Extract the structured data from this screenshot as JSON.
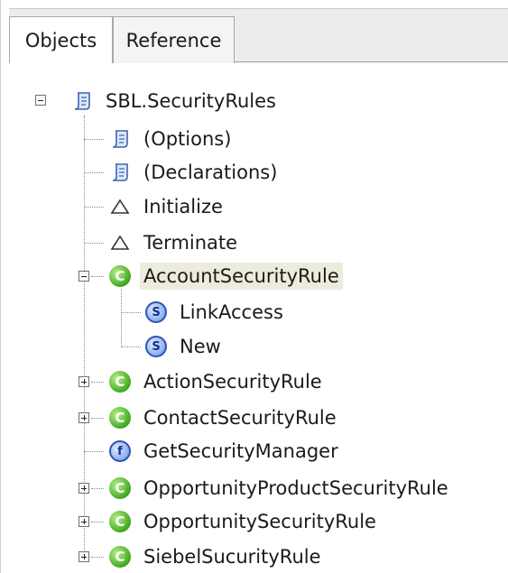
{
  "tabs": [
    {
      "label": "Objects",
      "active": true
    },
    {
      "label": "Reference",
      "active": false
    }
  ],
  "tree": {
    "root": {
      "label": "SBL.SecurityRules",
      "icon": "script-icon",
      "expanded": true
    },
    "items": [
      {
        "label": "(Options)",
        "icon": "script-icon"
      },
      {
        "label": "(Declarations)",
        "icon": "script-icon"
      },
      {
        "label": "Initialize",
        "icon": "triangle-icon"
      },
      {
        "label": "Terminate",
        "icon": "triangle-icon"
      },
      {
        "label": "AccountSecurityRule",
        "icon": "class-icon",
        "expanded": true,
        "selected": true,
        "children": [
          {
            "label": "LinkAccess",
            "icon": "sub-icon"
          },
          {
            "label": "New",
            "icon": "sub-icon"
          }
        ]
      },
      {
        "label": "ActionSecurityRule",
        "icon": "class-icon",
        "expanded": false
      },
      {
        "label": "ContactSecurityRule",
        "icon": "class-icon",
        "expanded": false
      },
      {
        "label": "GetSecurityManager",
        "icon": "function-icon"
      },
      {
        "label": "OpportunityProductSecurityRule",
        "icon": "class-icon",
        "expanded": false
      },
      {
        "label": "OpportunitySecurityRule",
        "icon": "class-icon",
        "expanded": false
      },
      {
        "label": "SiebelSucurityRule",
        "icon": "class-icon",
        "expanded": false
      }
    ]
  },
  "icon_glyphs": {
    "class": "C",
    "sub": "S",
    "function": "f"
  },
  "colors": {
    "selection": "#ecebdc",
    "class_icon": "#3fa81e",
    "sub_icon": "#3c62c0"
  }
}
